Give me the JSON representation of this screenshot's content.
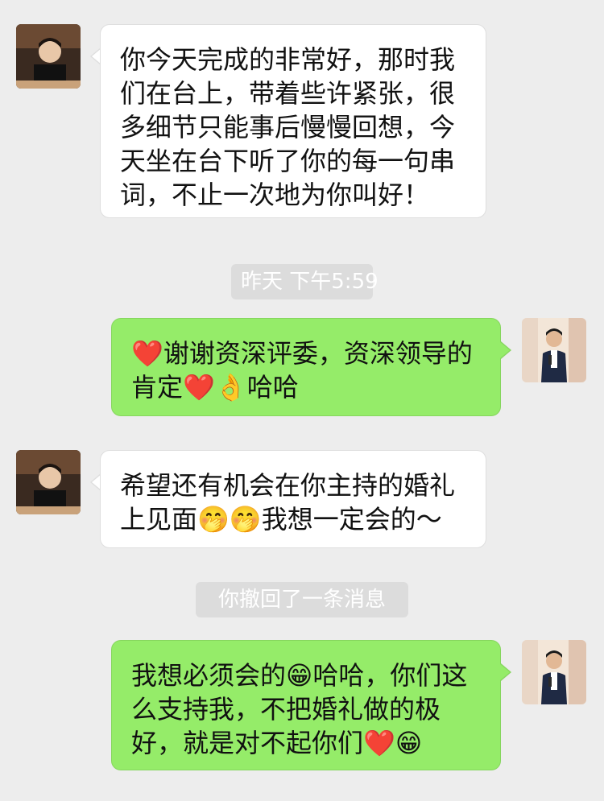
{
  "messages": [
    {
      "side": "left",
      "text": "你今天完成的非常好，那时我们在台上，带着些许紧张，很多细节只能事后慢慢回想，今天坐在台下听了你的每一句串词，不止一次地为你叫好！"
    },
    {
      "side": "right",
      "text": "❤️谢谢资深评委，资深领导的肯定❤️👌哈哈"
    },
    {
      "side": "left",
      "text": "希望还有机会在你主持的婚礼上见面🤭🤭我想一定会的～"
    },
    {
      "side": "right",
      "text": "我想必须会的😁哈哈，你们这么支持我，不把婚礼做的极好，就是对不起你们❤️😁"
    }
  ],
  "timestamp": "昨天 下午5:59",
  "system_notice": "你撤回了一条消息",
  "colors": {
    "background": "#ededed",
    "incoming_bubble": "#ffffff",
    "outgoing_bubble": "#95ec69",
    "pill": "#dcdcdc"
  }
}
